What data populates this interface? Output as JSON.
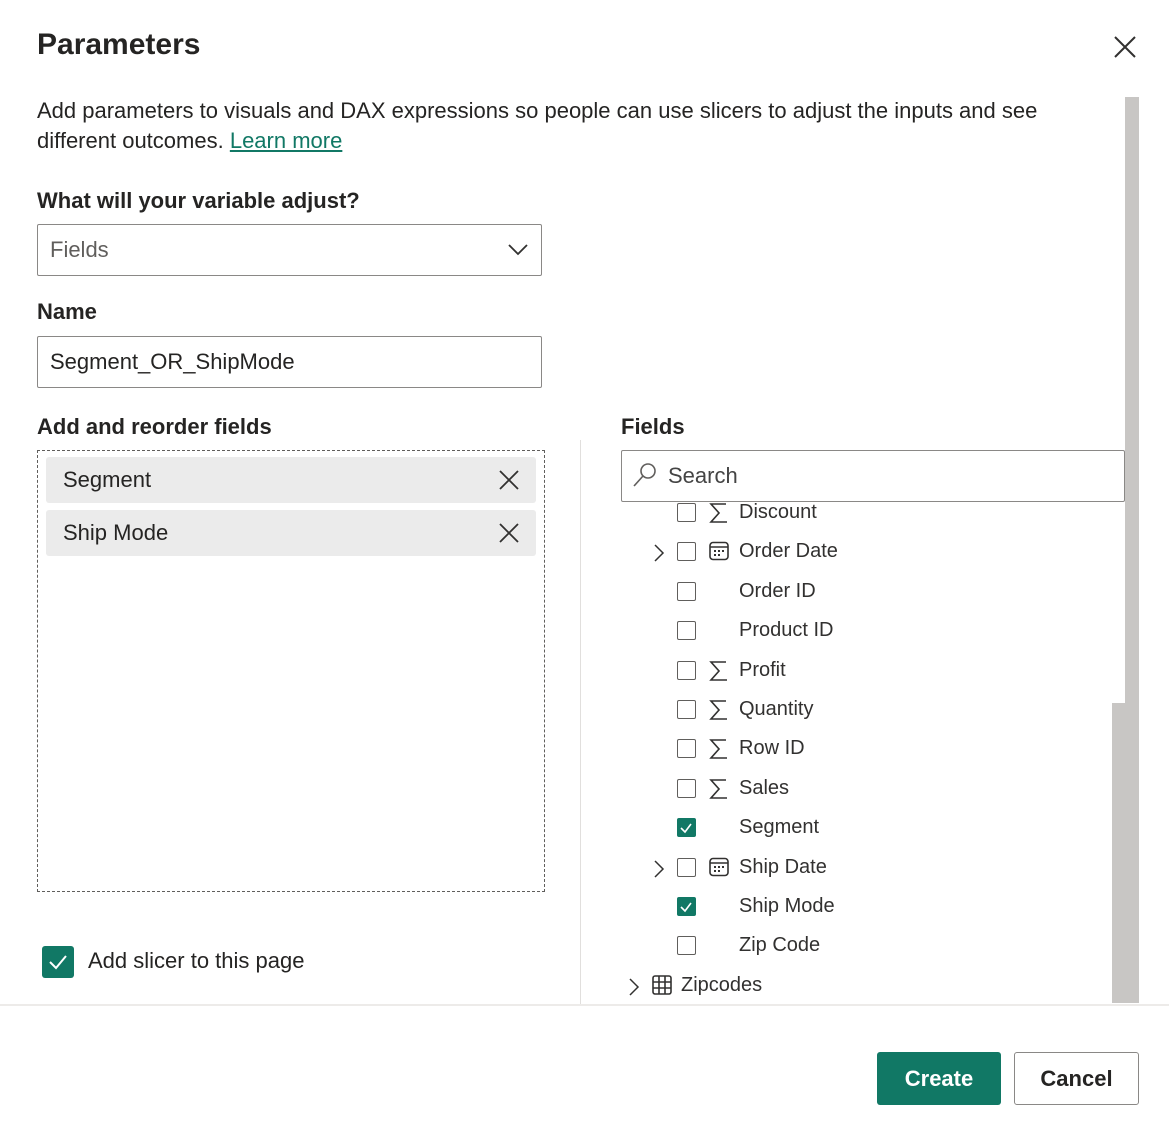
{
  "dialog": {
    "title": "Parameters",
    "description": "Add parameters to visuals and DAX expressions so people can use slicers to adjust the inputs and see different outcomes.",
    "learn_more": "Learn more"
  },
  "adjust": {
    "label": "What will your variable adjust?",
    "value": "Fields"
  },
  "name": {
    "label": "Name",
    "value": "Segment_OR_ShipMode"
  },
  "reorder": {
    "label": "Add and reorder fields",
    "items": [
      {
        "label": "Segment"
      },
      {
        "label": "Ship Mode"
      }
    ]
  },
  "fields": {
    "label": "Fields",
    "search_placeholder": "Search",
    "items": [
      {
        "label": "Discount",
        "icon": "sigma-icon",
        "checked": false,
        "expandable": false
      },
      {
        "label": "Order Date",
        "icon": "calendar-icon",
        "checked": false,
        "expandable": true
      },
      {
        "label": "Order ID",
        "icon": "",
        "checked": false,
        "expandable": false
      },
      {
        "label": "Product ID",
        "icon": "",
        "checked": false,
        "expandable": false
      },
      {
        "label": "Profit",
        "icon": "sigma-icon",
        "checked": false,
        "expandable": false
      },
      {
        "label": "Quantity",
        "icon": "sigma-icon",
        "checked": false,
        "expandable": false
      },
      {
        "label": "Row ID",
        "icon": "sigma-icon",
        "checked": false,
        "expandable": false
      },
      {
        "label": "Sales",
        "icon": "sigma-icon",
        "checked": false,
        "expandable": false
      },
      {
        "label": "Segment",
        "icon": "",
        "checked": true,
        "expandable": false
      },
      {
        "label": "Ship Date",
        "icon": "calendar-icon",
        "checked": false,
        "expandable": true
      },
      {
        "label": "Ship Mode",
        "icon": "",
        "checked": true,
        "expandable": false
      },
      {
        "label": "Zip Code",
        "icon": "",
        "checked": false,
        "expandable": false
      }
    ],
    "tables": [
      {
        "label": "Zipcodes",
        "icon": "table-icon"
      }
    ]
  },
  "slicer": {
    "label": "Add slicer to this page",
    "checked": true
  },
  "buttons": {
    "create": "Create",
    "cancel": "Cancel"
  },
  "colors": {
    "accent": "#117865"
  }
}
